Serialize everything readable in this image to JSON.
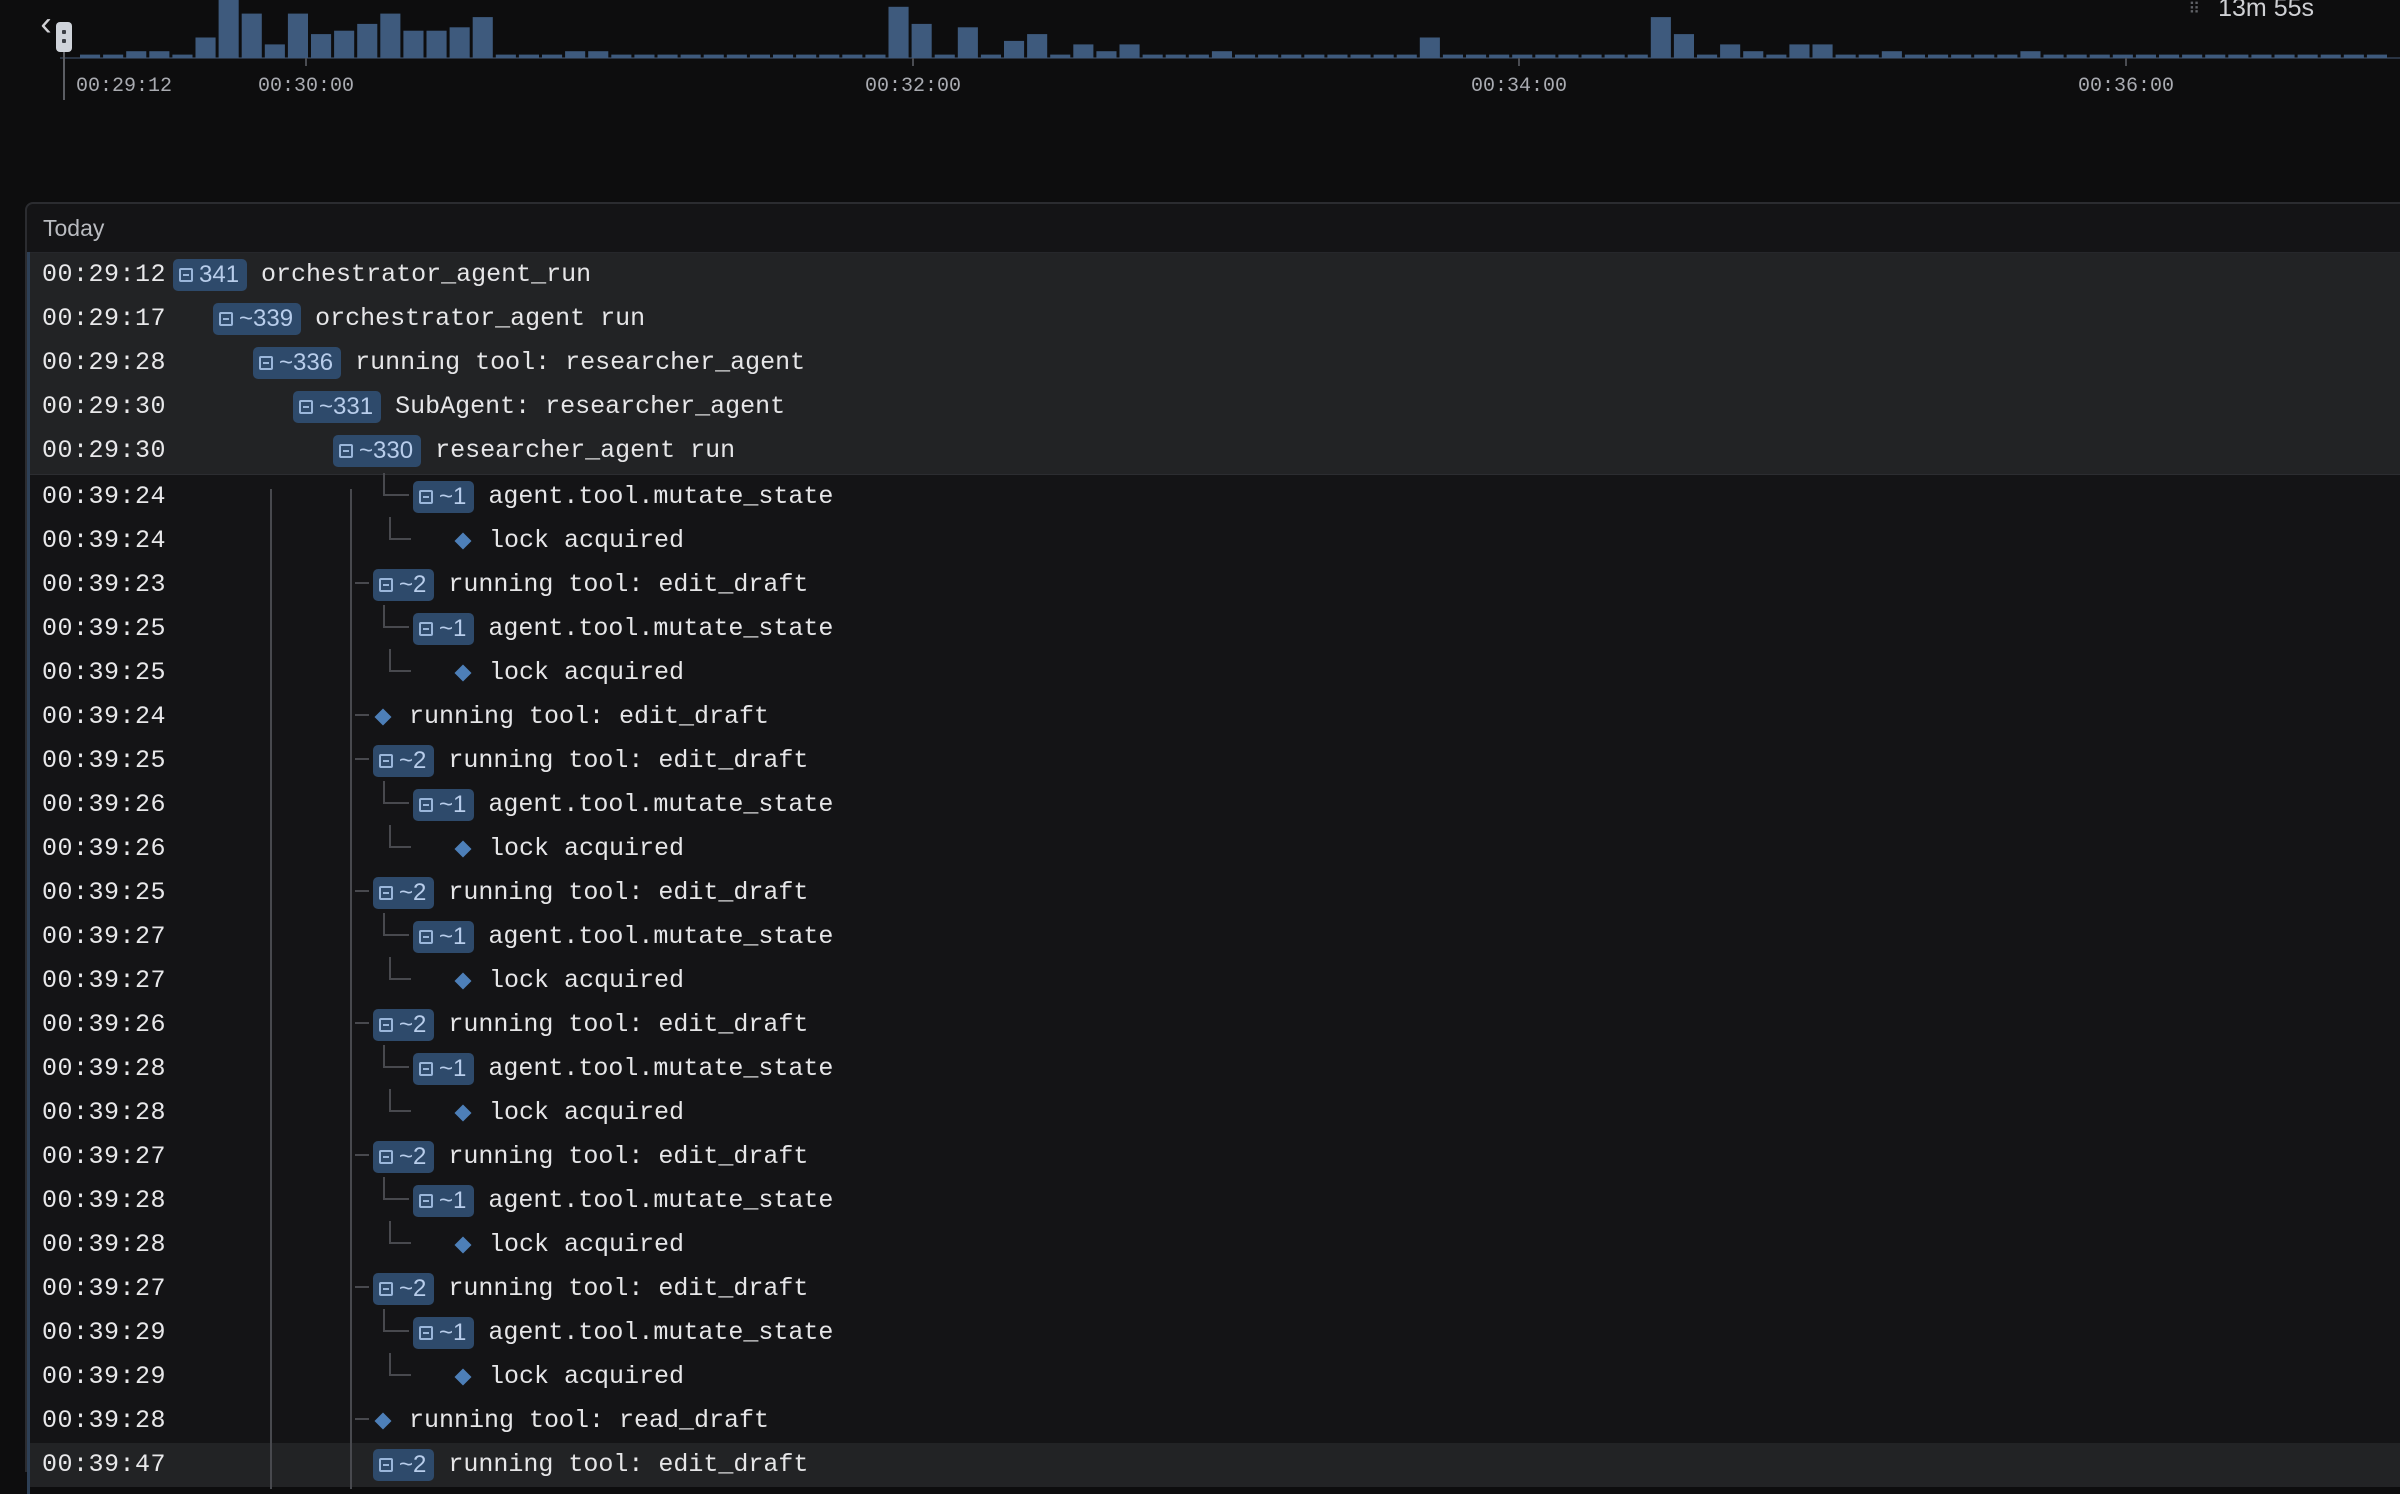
{
  "timeline": {
    "duration": "13m 55s",
    "tick_labels": [
      "00:29:12",
      "00:30:00",
      "00:32:00",
      "00:34:00",
      "00:36:00"
    ],
    "bar_color": "#3e5a7d",
    "bars": [
      1,
      1,
      2,
      2,
      1,
      6,
      17,
      13,
      4,
      13,
      7,
      8,
      10,
      13,
      8,
      8,
      9,
      12,
      1,
      1,
      1,
      2,
      2,
      1,
      1,
      1,
      1,
      1,
      1,
      1,
      1,
      1,
      1,
      1,
      1,
      15,
      10,
      1,
      9,
      1,
      5,
      7,
      1,
      4,
      2,
      4,
      1,
      1,
      1,
      2,
      1,
      1,
      1,
      1,
      1,
      1,
      1,
      1,
      6,
      1,
      1,
      1,
      1,
      1,
      1,
      1,
      1,
      1,
      12,
      7,
      1,
      4,
      2,
      1,
      4,
      4,
      1,
      1,
      2,
      1,
      1,
      1,
      1,
      1,
      2,
      1,
      1,
      1,
      1,
      1,
      1,
      1,
      1,
      1,
      1,
      1,
      1,
      1,
      1,
      1
    ]
  },
  "group": {
    "label": "Today"
  },
  "rows": [
    {
      "ts": "00:29:12",
      "badge": "341",
      "label": "orchestrator_agent_run",
      "depth": 0,
      "sticky": true
    },
    {
      "ts": "00:29:17",
      "badge": "~339",
      "label": "orchestrator_agent run",
      "depth": 1,
      "sticky": true
    },
    {
      "ts": "00:29:28",
      "badge": "~336",
      "label": "running tool: researcher_agent",
      "depth": 2,
      "sticky": true
    },
    {
      "ts": "00:29:30",
      "badge": "~331",
      "label": "SubAgent: researcher_agent",
      "depth": 3,
      "sticky": true
    },
    {
      "ts": "00:29:30",
      "badge": "~330",
      "label": "researcher_agent run",
      "depth": 4,
      "sticky": true
    },
    {
      "ts": "00:39:24",
      "badge": "~1",
      "label": "agent.tool.mutate_state",
      "depth": 6
    },
    {
      "ts": "00:39:24",
      "badge": "",
      "label": "lock acquired",
      "depth": 7
    },
    {
      "ts": "00:39:23",
      "badge": "~2",
      "label": "running tool: edit_draft",
      "depth": 5
    },
    {
      "ts": "00:39:25",
      "badge": "~1",
      "label": "agent.tool.mutate_state",
      "depth": 6
    },
    {
      "ts": "00:39:25",
      "badge": "",
      "label": "lock acquired",
      "depth": 7
    },
    {
      "ts": "00:39:24",
      "badge": "",
      "label": "running tool: edit_draft",
      "depth": 5
    },
    {
      "ts": "00:39:25",
      "badge": "~2",
      "label": "running tool: edit_draft",
      "depth": 5
    },
    {
      "ts": "00:39:26",
      "badge": "~1",
      "label": "agent.tool.mutate_state",
      "depth": 6
    },
    {
      "ts": "00:39:26",
      "badge": "",
      "label": "lock acquired",
      "depth": 7
    },
    {
      "ts": "00:39:25",
      "badge": "~2",
      "label": "running tool: edit_draft",
      "depth": 5
    },
    {
      "ts": "00:39:27",
      "badge": "~1",
      "label": "agent.tool.mutate_state",
      "depth": 6
    },
    {
      "ts": "00:39:27",
      "badge": "",
      "label": "lock acquired",
      "depth": 7
    },
    {
      "ts": "00:39:26",
      "badge": "~2",
      "label": "running tool: edit_draft",
      "depth": 5
    },
    {
      "ts": "00:39:28",
      "badge": "~1",
      "label": "agent.tool.mutate_state",
      "depth": 6
    },
    {
      "ts": "00:39:28",
      "badge": "",
      "label": "lock acquired",
      "depth": 7
    },
    {
      "ts": "00:39:27",
      "badge": "~2",
      "label": "running tool: edit_draft",
      "depth": 5
    },
    {
      "ts": "00:39:28",
      "badge": "~1",
      "label": "agent.tool.mutate_state",
      "depth": 6
    },
    {
      "ts": "00:39:28",
      "badge": "",
      "label": "lock acquired",
      "depth": 7
    },
    {
      "ts": "00:39:27",
      "badge": "~2",
      "label": "running tool: edit_draft",
      "depth": 5
    },
    {
      "ts": "00:39:29",
      "badge": "~1",
      "label": "agent.tool.mutate_state",
      "depth": 6
    },
    {
      "ts": "00:39:29",
      "badge": "",
      "label": "lock acquired",
      "depth": 7
    },
    {
      "ts": "00:39:28",
      "badge": "",
      "label": "running tool: read_draft",
      "depth": 5
    },
    {
      "ts": "00:39:47",
      "badge": "~2",
      "label": "running tool: edit_draft",
      "depth": 5,
      "sticky": true
    }
  ]
}
